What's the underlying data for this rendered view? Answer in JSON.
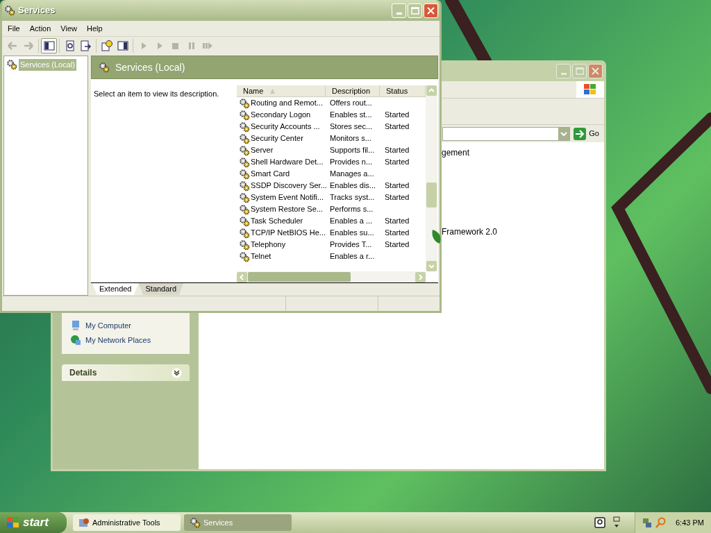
{
  "background_window": {
    "address_go": "Go",
    "visible_text": [
      "gement",
      "Framework 2.0"
    ],
    "links": [
      {
        "label": "My Computer",
        "kind": "computer"
      },
      {
        "label": "My Network Places",
        "kind": "network"
      }
    ],
    "details_panel": {
      "title": "Details",
      "expanded": false
    }
  },
  "services_window": {
    "title": "Services",
    "menu": [
      "File",
      "Action",
      "View",
      "Help"
    ],
    "toolbar": [
      {
        "kind": "back",
        "disabled": true,
        "pressed": false
      },
      {
        "kind": "forward",
        "disabled": true,
        "pressed": false
      },
      {
        "kind": "tree",
        "disabled": false,
        "pressed": true
      },
      {
        "kind": "refresh",
        "disabled": false,
        "pressed": false
      },
      {
        "kind": "export",
        "disabled": false,
        "pressed": false
      },
      {
        "kind": "help",
        "disabled": false,
        "pressed": false
      },
      {
        "kind": "pane",
        "disabled": false,
        "pressed": false
      },
      {
        "kind": "start",
        "disabled": true,
        "pressed": false
      },
      {
        "kind": "start",
        "disabled": true,
        "pressed": false
      },
      {
        "kind": "stop",
        "disabled": true,
        "pressed": false
      },
      {
        "kind": "pause",
        "disabled": true,
        "pressed": false
      },
      {
        "kind": "restart",
        "disabled": true,
        "pressed": false
      }
    ],
    "tree": [
      {
        "label": "Services (Local)",
        "selected": true
      }
    ],
    "header": "Services (Local)",
    "description_hint": "Select an item to view its description.",
    "columns": [
      {
        "label": "Name",
        "sorted": true
      },
      {
        "label": "Description",
        "sorted": false
      },
      {
        "label": "Status",
        "sorted": false
      }
    ],
    "rows": [
      {
        "name": "Routing and Remot...",
        "description": "Offers rout..."
      },
      {
        "name": "Secondary Logon",
        "description": "Enables st...",
        "status": "Started"
      },
      {
        "name": "Security Accounts ...",
        "description": "Stores sec...",
        "status": "Started"
      },
      {
        "name": "Security Center",
        "description": "Monitors s..."
      },
      {
        "name": "Server",
        "description": "Supports fil...",
        "status": "Started"
      },
      {
        "name": "Shell Hardware Det...",
        "description": "Provides n...",
        "status": "Started"
      },
      {
        "name": "Smart Card",
        "description": "Manages a..."
      },
      {
        "name": "SSDP Discovery Ser...",
        "description": "Enables dis...",
        "status": "Started"
      },
      {
        "name": "System Event Notifi...",
        "description": "Tracks syst...",
        "status": "Started"
      },
      {
        "name": "System Restore Se...",
        "description": "Performs s..."
      },
      {
        "name": "Task Scheduler",
        "description": "Enables a ...",
        "status": "Started"
      },
      {
        "name": "TCP/IP NetBIOS He...",
        "description": "Enables su...",
        "status": "Started"
      },
      {
        "name": "Telephony",
        "description": "Provides T...",
        "status": "Started"
      },
      {
        "name": "Telnet",
        "description": "Enables a r..."
      }
    ],
    "tabs": [
      {
        "label": "Extended",
        "selected": true
      },
      {
        "label": "Standard",
        "selected": false
      }
    ]
  },
  "taskbar": {
    "start": "start",
    "tasks": [
      {
        "label": "Administrative Tools",
        "kind": "tools",
        "selected": false
      },
      {
        "label": "Services",
        "kind": "services",
        "selected": true
      }
    ],
    "clock": "6:43 PM"
  }
}
